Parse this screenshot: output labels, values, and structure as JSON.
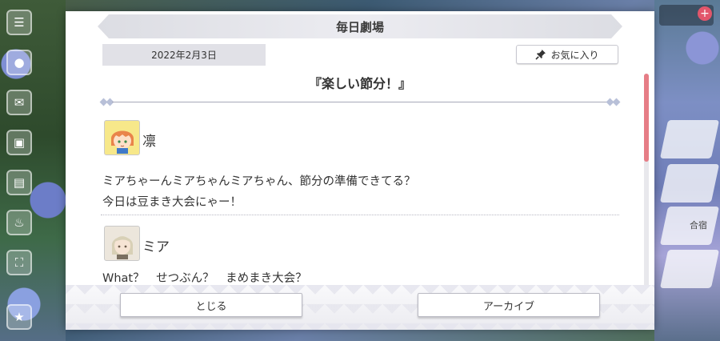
{
  "header": {
    "title": "毎日劇場"
  },
  "meta": {
    "date": "2022年2月3日"
  },
  "favorite": {
    "label": "お気に入り",
    "icon": "pin-icon"
  },
  "story": {
    "title": "『楽しい節分！』"
  },
  "dialogue": [
    {
      "speaker": "凛",
      "avatar": "rin-avatar-icon",
      "lines": [
        "ミアちゃーんミアちゃんミアちゃん、節分の準備できてる？",
        "今日は豆まき大会にゃー！"
      ]
    },
    {
      "speaker": "ミア",
      "avatar": "mia-avatar-icon",
      "lines": [
        "What？　せつぶん？　まめまき大会？"
      ]
    }
  ],
  "footer": {
    "close_label": "とじる",
    "archive_label": "アーカイブ"
  },
  "colors": {
    "accent": "#e67d86",
    "panel": "#ffffff",
    "banner": "#e1e1e7"
  },
  "background": {
    "right_tile_label": "合宿"
  }
}
